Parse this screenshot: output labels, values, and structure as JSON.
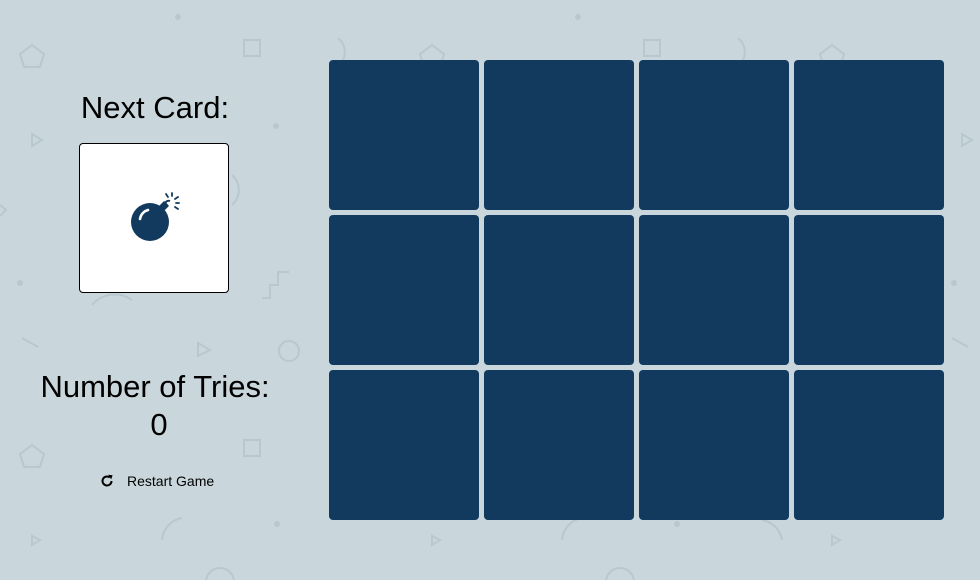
{
  "game": {
    "next_card_label": "Next Card:",
    "next_card_icon": "bomb-icon",
    "tries_label": "Number of Tries:",
    "tries_count": "0",
    "restart_label": "Restart Game",
    "restart_icon": "restart-icon"
  },
  "board": {
    "rows": 3,
    "columns": 4,
    "card_state": "face-down",
    "card_color": "#113a5e"
  },
  "colors": {
    "background": "#c9d7dc",
    "card_back": "#113a5e",
    "next_card_face": "#ffffff"
  }
}
